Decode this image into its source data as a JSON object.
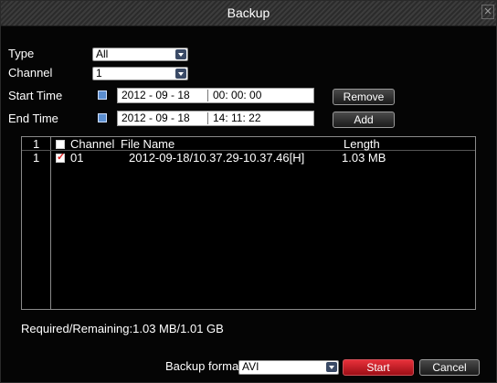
{
  "window": {
    "title": "Backup",
    "close_icon": "close-icon"
  },
  "form": {
    "type_label": "Type",
    "type_value": "All",
    "channel_label": "Channel",
    "channel_value": "1",
    "start_label": "Start Time",
    "start_date": "2012 - 09 - 18",
    "start_time": "00: 00: 00",
    "end_label": "End Time",
    "end_date": "2012 - 09 - 18",
    "end_time": "14: 11: 22",
    "remove_label": "Remove",
    "add_label": "Add"
  },
  "table": {
    "header_num": "1",
    "header_channel": "Channel",
    "header_file": "File Name",
    "header_length": "Length",
    "rows": [
      {
        "num": "1",
        "checked": true,
        "channel": "01",
        "file": "2012-09-18/10.37.29-10.37.46[H]",
        "length": "1.03 MB"
      }
    ]
  },
  "status": {
    "required_remaining": "Required/Remaining:1.03 MB/1.01 GB"
  },
  "footer": {
    "format_label": "Backup format",
    "format_value": "AVI",
    "start_label": "Start",
    "cancel_label": "Cancel"
  }
}
